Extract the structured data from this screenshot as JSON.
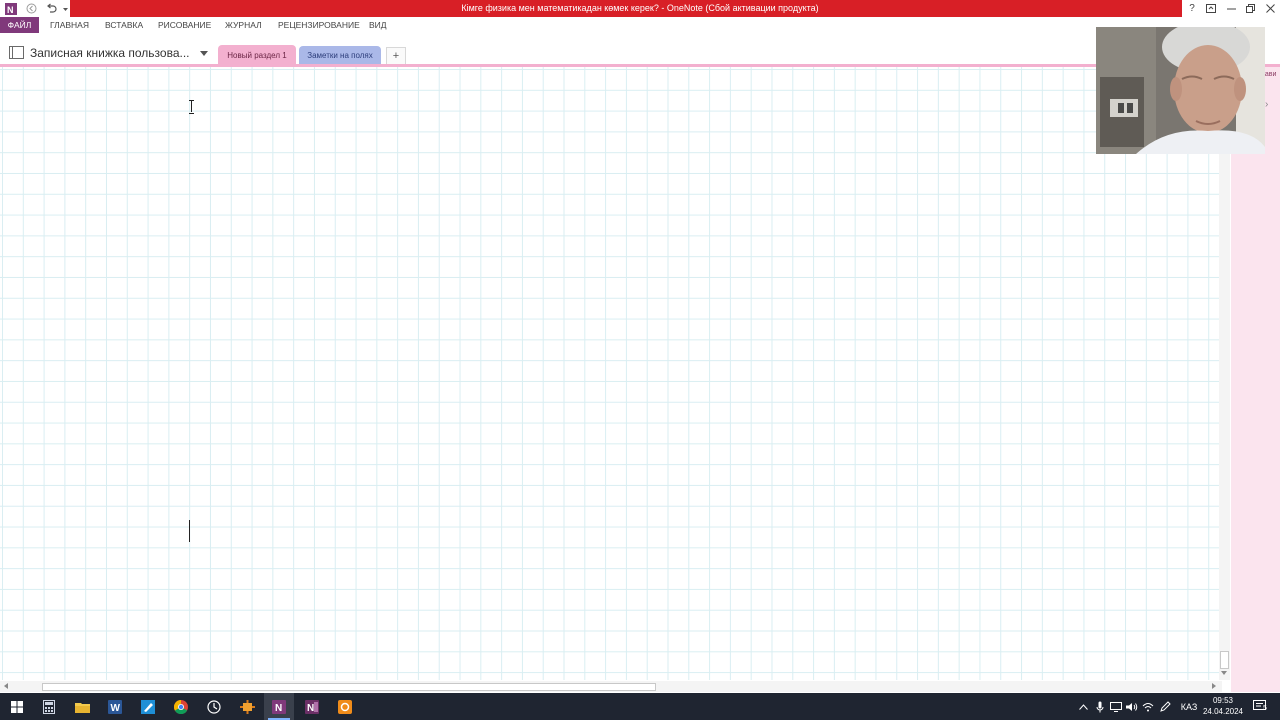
{
  "window": {
    "title": "Кімге физика мен математикадан көмек керек? - OneNote (Сбой активации продукта)"
  },
  "ribbon": {
    "tabs": [
      {
        "label": "ФАЙЛ"
      },
      {
        "label": "ГЛАВНАЯ"
      },
      {
        "label": "ВСТАВКА"
      },
      {
        "label": "РИСОВАНИЕ"
      },
      {
        "label": "ЖУРНАЛ"
      },
      {
        "label": "РЕЦЕНЗИРОВАНИЕ"
      },
      {
        "label": "ВИД"
      }
    ]
  },
  "notebook": {
    "name": "Записная книжка пользова...",
    "sections": [
      {
        "label": "Новый раздел 1",
        "active": true
      },
      {
        "label": "Заметки на полях",
        "active": false
      }
    ],
    "add_section_label": "+"
  },
  "pages_pane": {
    "label": "бави"
  },
  "taskbar": {
    "apps": [
      "start",
      "calculator",
      "file-explorer",
      "word",
      "paint",
      "chrome",
      "clock-app",
      "app",
      "onenote",
      "onenote-2",
      "orange-app"
    ],
    "tray": {
      "language": "КАЗ",
      "time": "09:53",
      "date": "24.04.2024",
      "notifications": "5"
    }
  },
  "colors": {
    "title_bar": "#d81f26",
    "file_tab": "#80397b",
    "active_section": "#f3b0cf",
    "inactive_section": "#aab8e8",
    "grid": "#d9eef2",
    "taskbar": "#1f2531"
  }
}
